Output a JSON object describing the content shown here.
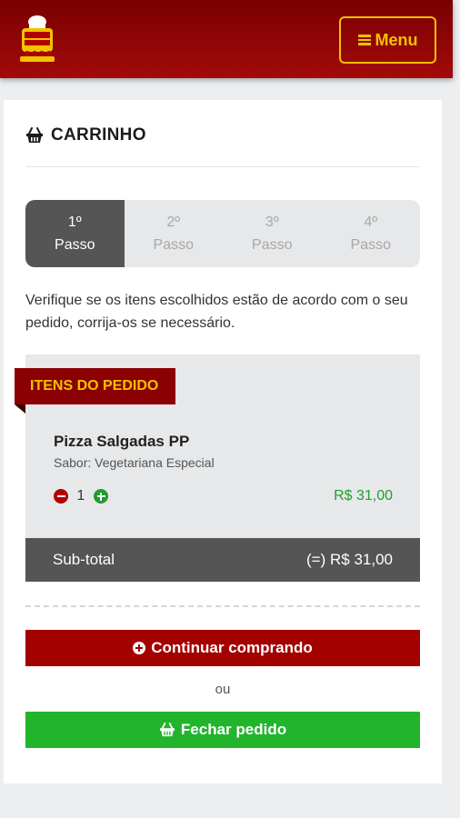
{
  "header": {
    "menu_label": "Menu",
    "logo_icon": "pizza-restaurant-logo",
    "accent_color": "#f2c200",
    "brand_color": "#8b0000"
  },
  "cart": {
    "title": "CARRINHO",
    "title_icon": "basket-icon",
    "steps": [
      {
        "number": "1º",
        "label": "Passo",
        "active": true
      },
      {
        "number": "2º",
        "label": "Passo",
        "active": false
      },
      {
        "number": "3º",
        "label": "Passo",
        "active": false
      },
      {
        "number": "4º",
        "label": "Passo",
        "active": false
      }
    ],
    "instructions": "Verifique se os itens escolhidos estão de acordo com o seu pedido, corrija-os se necessário.",
    "section_label": "ITENS DO PEDIDO",
    "items": [
      {
        "name": "Pizza Salgadas PP",
        "flavor": "Sabor: Vegetariana Especial",
        "quantity": "1",
        "price": "R$ 31,00"
      }
    ],
    "subtotal_label": "Sub-total",
    "subtotal_value": "(=) R$ 31,00",
    "continue_label": "Continuar comprando",
    "or_label": "ou",
    "checkout_label": "Fechar pedido"
  }
}
